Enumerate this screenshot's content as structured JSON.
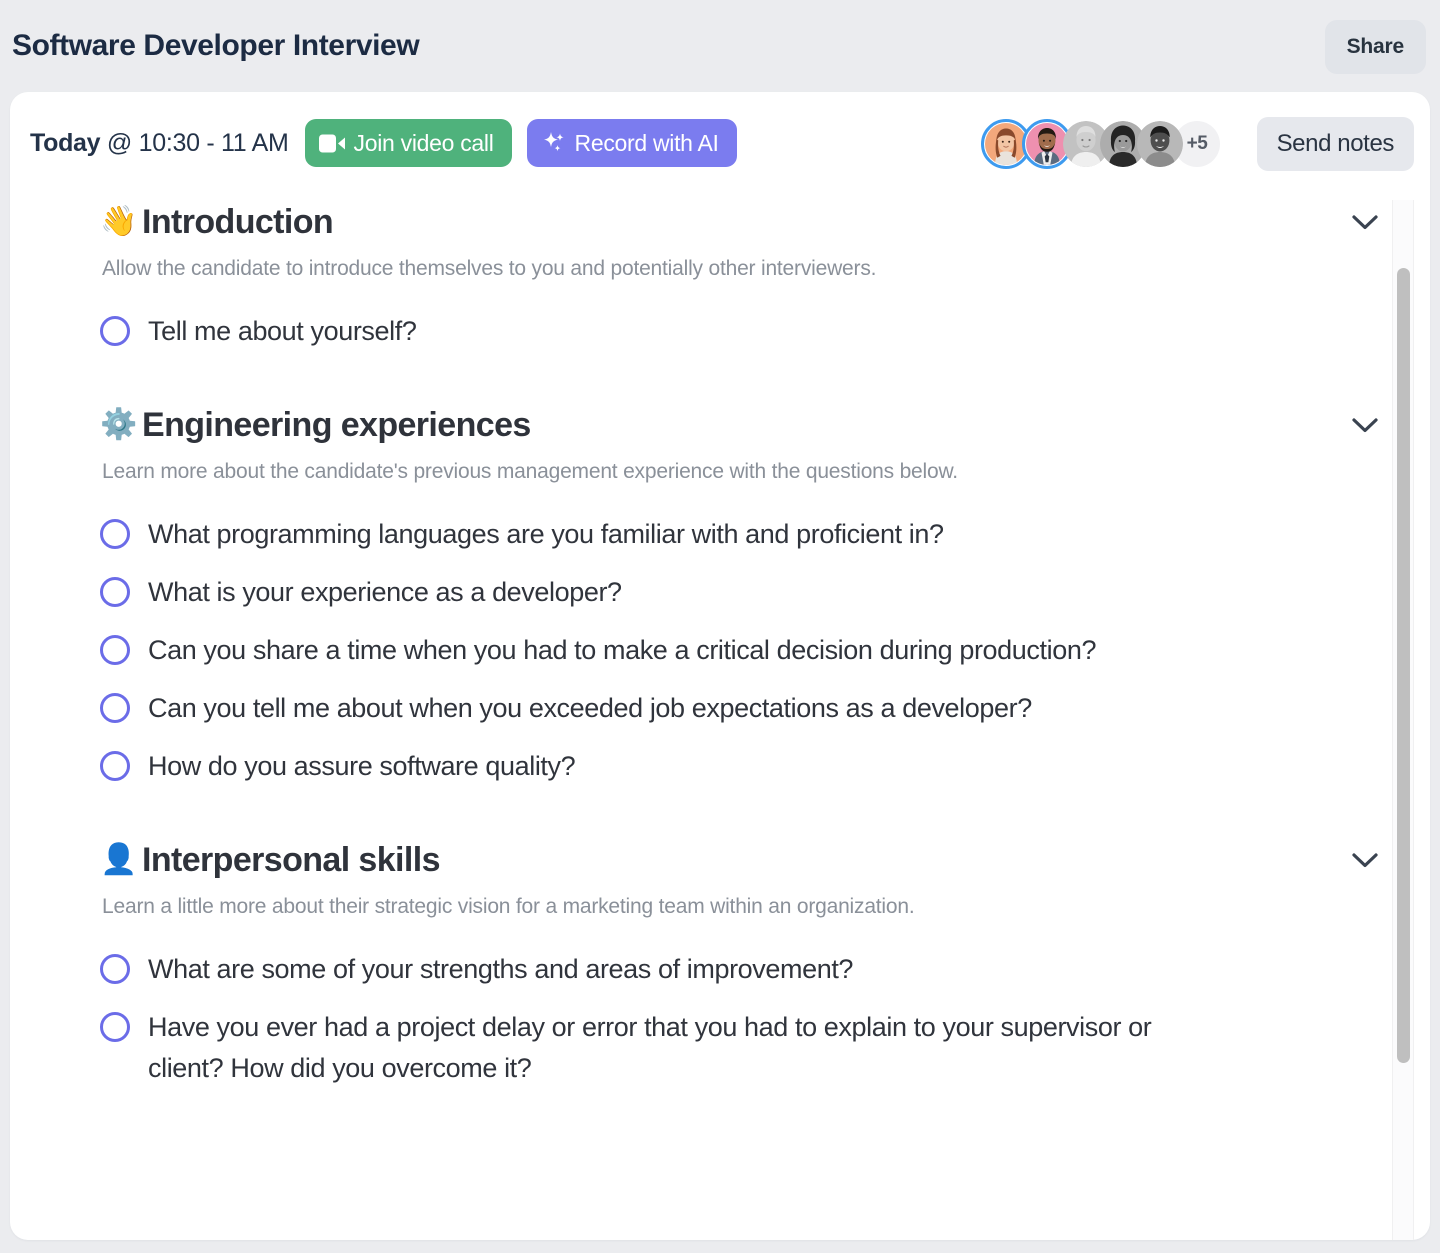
{
  "header": {
    "title": "Software Developer Interview",
    "share_label": "Share"
  },
  "meeting": {
    "day": "Today",
    "time": "@ 10:30 - 11 AM",
    "join_label": "Join video call",
    "record_label": "Record with AI",
    "send_notes_label": "Send notes",
    "avatar_overflow": "+5",
    "colors": {
      "join_bg": "#4FB27C",
      "record_bg": "#7B7CEF",
      "button_bg": "#E6E8ED",
      "avatar_ring": "#3E9BEF"
    },
    "participants": [
      {
        "name": "participant-1",
        "ringed": true,
        "bg": "#F2A97E",
        "hair": "#7A4A2B",
        "skin": "#F0C3A0",
        "grayscale": false
      },
      {
        "name": "participant-2",
        "ringed": true,
        "bg": "#EE8FAE",
        "hair": "#2C2018",
        "skin": "#9C6A4A",
        "grayscale": false
      },
      {
        "name": "participant-3",
        "ringed": false,
        "bg": "#BFBFBF",
        "hair": "#D8D8D8",
        "skin": "#C9C9C9",
        "grayscale": true
      },
      {
        "name": "participant-4",
        "ringed": false,
        "bg": "#A8A8A8",
        "hair": "#2E2E2E",
        "skin": "#8F8F8F",
        "grayscale": true
      },
      {
        "name": "participant-5",
        "ringed": false,
        "bg": "#B5B5B5",
        "hair": "#1E1E1E",
        "skin": "#4A4A4A",
        "grayscale": true
      }
    ]
  },
  "sections": [
    {
      "emoji": "👋",
      "emoji_name": "waving-hand-emoji",
      "title": "Introduction",
      "description": "Allow the candidate to introduce themselves to you and potentially other interviewers.",
      "questions": [
        "Tell me about yourself?"
      ]
    },
    {
      "emoji": "⚙️",
      "emoji_name": "gear-emoji",
      "title": "Engineering experiences",
      "description": "Learn more about the candidate's previous management experience with the questions below.",
      "questions": [
        "What programming languages are you familiar with and proficient in?",
        "What is your experience as a developer?",
        "Can you share a time when you had to make a critical decision during production?",
        "Can you tell me about when you exceeded job expectations as a developer?",
        "How do you assure software quality?"
      ]
    },
    {
      "emoji": "👤",
      "emoji_name": "bust-in-silhouette-emoji",
      "title": "Interpersonal skills",
      "description": "Learn a little more about their strategic vision for a marketing team within an organization.",
      "questions": [
        "What are some of your strengths and areas of improvement?",
        "Have you ever had a project delay or error that you had to explain to your supervisor or client? How did you overcome it?"
      ]
    }
  ]
}
